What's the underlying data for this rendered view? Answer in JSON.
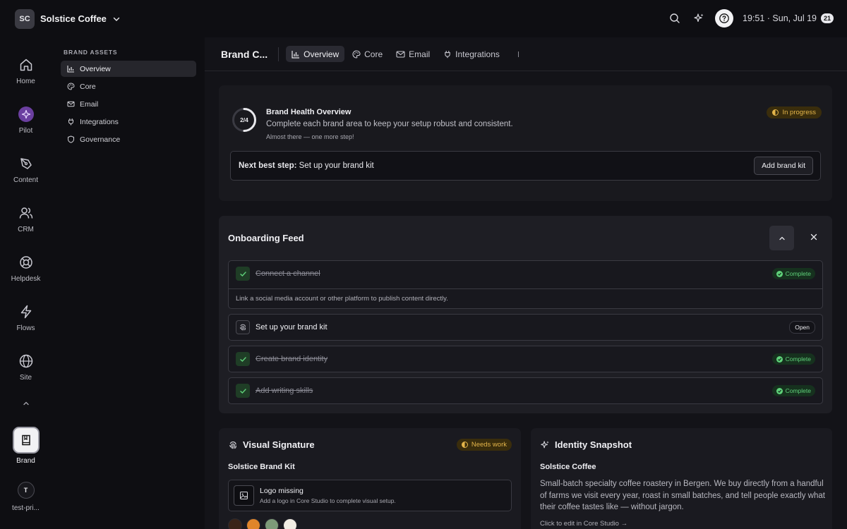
{
  "workspace": {
    "initials": "SC",
    "name": "Solstice Coffee"
  },
  "topbar": {
    "clock": "19:51 · Sun, Jul 19",
    "notification_count": "21"
  },
  "rail": {
    "items": [
      {
        "label": "Home",
        "icon": "home-icon"
      },
      {
        "label": "Pilot",
        "icon": "pilot-icon"
      },
      {
        "label": "Content",
        "icon": "pen-nib-icon"
      },
      {
        "label": "CRM",
        "icon": "users-icon"
      },
      {
        "label": "Helpdesk",
        "icon": "lifebuoy-icon"
      },
      {
        "label": "Flows",
        "icon": "lightning-icon"
      },
      {
        "label": "Site",
        "icon": "globe-icon"
      }
    ],
    "brand_label": "Brand",
    "user_initial": "T",
    "user_label": "test-pri..."
  },
  "subnav": {
    "title": "BRAND ASSETS",
    "items": [
      {
        "label": "Overview",
        "icon": "bar-chart-icon",
        "active": true
      },
      {
        "label": "Core",
        "icon": "palette-icon"
      },
      {
        "label": "Email",
        "icon": "mail-icon"
      },
      {
        "label": "Integrations",
        "icon": "plug-icon"
      },
      {
        "label": "Governance",
        "icon": "shield-icon"
      }
    ]
  },
  "main": {
    "title": "Brand C...",
    "tabs": [
      {
        "label": "Overview",
        "active": true
      },
      {
        "label": "Core"
      },
      {
        "label": "Email"
      },
      {
        "label": "Integrations"
      }
    ]
  },
  "health": {
    "progress_text": "2/4",
    "progress_fraction": 0.5,
    "title": "Brand Health Overview",
    "subtitle": "Complete each brand area to keep your setup robust and consistent.",
    "note": "Almost there — one more step!",
    "status": "In progress",
    "next_label": "Next best step:",
    "next_text": "Set up your brand kit",
    "button": "Add brand kit"
  },
  "feed": {
    "title": "Onboarding Feed",
    "tasks": [
      {
        "label": "Connect a channel",
        "status": "Complete",
        "description": "Link a social media account or other platform to publish content directly."
      },
      {
        "label": "Set up your brand kit",
        "status": "Open"
      },
      {
        "label": "Create brand identity",
        "status": "Complete"
      },
      {
        "label": "Add writing skills",
        "status": "Complete"
      }
    ]
  },
  "visual_signature": {
    "title": "Visual Signature",
    "status": "Needs work",
    "kit_name": "Solstice Brand Kit",
    "logo_title": "Logo missing",
    "logo_sub": "Add a logo in Core Studio to complete visual setup.",
    "swatches": [
      "#3a2418",
      "#e0852a",
      "#7d9a78",
      "#f2ede4"
    ]
  },
  "identity": {
    "title": "Identity Snapshot",
    "name": "Solstice Coffee",
    "body": "Small-batch specialty coffee roastery in Bergen. We buy directly from a handful of farms we visit every year, roast in small batches, and tell people exactly what their coffee tastes like — without jargon.",
    "link": "Click to edit in Core Studio →"
  }
}
